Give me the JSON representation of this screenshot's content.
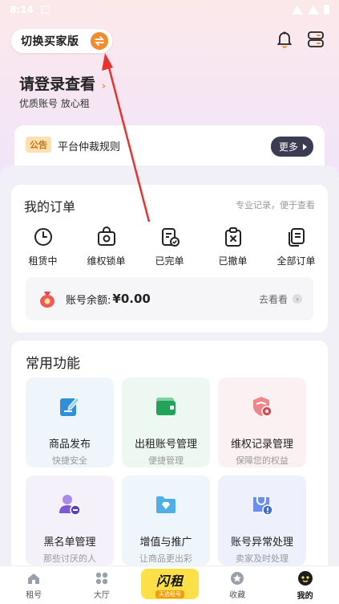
{
  "status_bar": {
    "time": "8:14"
  },
  "header": {
    "switch_label": "切换买家版"
  },
  "login": {
    "title": "请登录查看",
    "subtitle": "优质账号 放心租"
  },
  "notice": {
    "tag": "公告",
    "text": "平台仲裁规则",
    "more": "更多"
  },
  "orders": {
    "title": "我的订单",
    "hint": "专业记录，便于查看",
    "items": [
      {
        "label": "租赁中",
        "icon": "clock-icon"
      },
      {
        "label": "维权锁单",
        "icon": "lock-bag-icon"
      },
      {
        "label": "已完单",
        "icon": "doc-check-icon"
      },
      {
        "label": "已撤单",
        "icon": "clipboard-x-icon"
      },
      {
        "label": "全部订单",
        "icon": "docs-icon"
      }
    ],
    "balance_label": "账号余额:",
    "balance_value": "¥0.00",
    "balance_action": "去看看"
  },
  "functions": {
    "title": "常用功能",
    "tiles": [
      {
        "title": "商品发布",
        "sub": "快捷安全",
        "icon": "edit-icon",
        "bg": "#eef5fb",
        "color": "#2f8fd8"
      },
      {
        "title": "出租账号管理",
        "sub": "便捷管理",
        "icon": "wallet-icon",
        "bg": "#eef8f2",
        "color": "#22a35a"
      },
      {
        "title": "维权记录管理",
        "sub": "保障您的权益",
        "icon": "shield-icon",
        "bg": "#fcf1f2",
        "color": "#e0484f"
      },
      {
        "title": "黑名单管理",
        "sub": "那些讨厌的人",
        "icon": "user-block-icon",
        "bg": "#f4f1fb",
        "color": "#7c5bd6"
      },
      {
        "title": "增值与推广",
        "sub": "让商品更出彩",
        "icon": "folder-diamond-icon",
        "bg": "#eef5fb",
        "color": "#2f8fd8"
      },
      {
        "title": "账号异常处理",
        "sub": "卖家及时处理",
        "icon": "bag-alert-icon",
        "bg": "#eef1fb",
        "color": "#3b6fd8"
      }
    ]
  },
  "tabbar": {
    "items": [
      {
        "label": "租号",
        "icon": "home-icon"
      },
      {
        "label": "大厅",
        "icon": "grid-icon"
      },
      {
        "label": "",
        "icon": ""
      },
      {
        "label": "收藏",
        "icon": "star-icon"
      },
      {
        "label": "我的",
        "icon": "profile-icon"
      }
    ],
    "flash_big": "闪租",
    "flash_small": "天选租号"
  }
}
